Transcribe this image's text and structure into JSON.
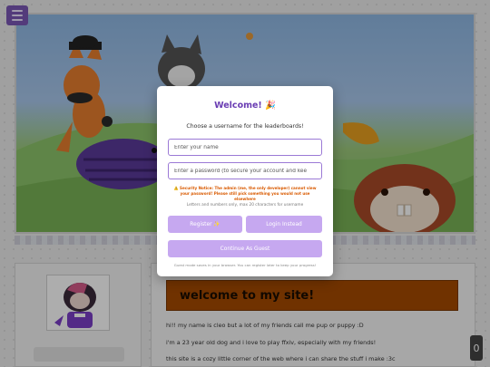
{
  "modal": {
    "title": "Welcome! 🎉",
    "subtitle": "Choose a username for the leaderboards!",
    "username_placeholder": "Enter your name",
    "password_placeholder": "Enter a password (to secure your account and kee",
    "security_notice": "⚠️ Security Notice: The admin (me, the only developer) cannot view your password! Please still pick something you would not use elsewhere",
    "hint": "Letters and numbers only, max 20 characters for username",
    "register_label": "Register ✨",
    "login_label": "Login Instead",
    "guest_label": "Continue As Guest",
    "footer": "Guest mode saves in your browser. You can register later to keep your progress!"
  },
  "main": {
    "title": "welcome to my site!",
    "paragraphs": [
      "hi!! my name is cleo but a lot of my friends call me pup or puppy :D",
      "i'm a 23 year old dog and i love to play ffxiv, especially with my friends!",
      "this site is a cozy little corner of the web where i can share the stuff i make :3c"
    ]
  },
  "scroll_counter": "0",
  "colors": {
    "accent": "#6a3db3",
    "button": "#c6a8f0",
    "title_bg": "#a64a00",
    "warning": "#d95a00"
  }
}
